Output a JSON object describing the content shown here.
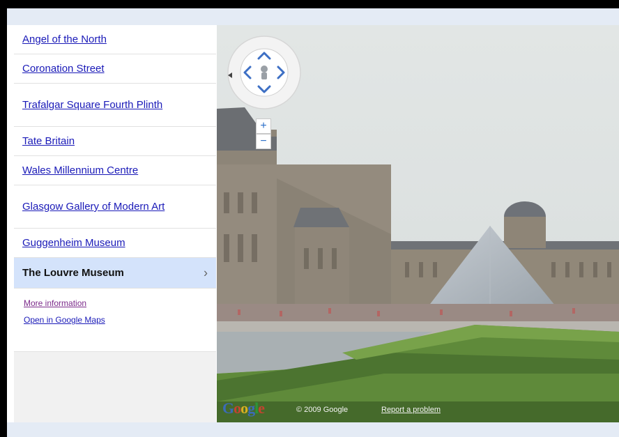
{
  "sidebar": {
    "items": [
      {
        "label": "Angel of the North"
      },
      {
        "label": "Coronation Street"
      },
      {
        "label": "Trafalgar Square Fourth Plinth"
      },
      {
        "label": "Tate Britain"
      },
      {
        "label": "Wales Millennium Centre"
      },
      {
        "label": "Glasgow Gallery of Modern Art"
      },
      {
        "label": "Guggenheim Museum"
      },
      {
        "label": "The Louvre Museum",
        "selected": true
      }
    ],
    "chevron": "›",
    "sub_links": {
      "more_info": "More information",
      "open_maps": "Open in Google Maps"
    }
  },
  "streetview": {
    "zoom_in": "+",
    "zoom_out": "−",
    "logo": {
      "letters": [
        "G",
        "o",
        "o",
        "g",
        "l",
        "e"
      ],
      "colors": [
        "#3b6cc7",
        "#d23f31",
        "#e9b820",
        "#3b6cc7",
        "#2a9a3a",
        "#d23f31"
      ]
    },
    "copyright": "© 2009 Google",
    "report_link": "Report a problem"
  },
  "colors": {
    "link": "#1a1ab8",
    "visited_link": "#7b2a8a",
    "selected_bg": "#d4e3fb",
    "chrome_bar": "#e4ebf5"
  },
  "icons": [
    "pan-arrows-icon",
    "pegman-icon",
    "compass-icon",
    "chevron-right-icon"
  ]
}
